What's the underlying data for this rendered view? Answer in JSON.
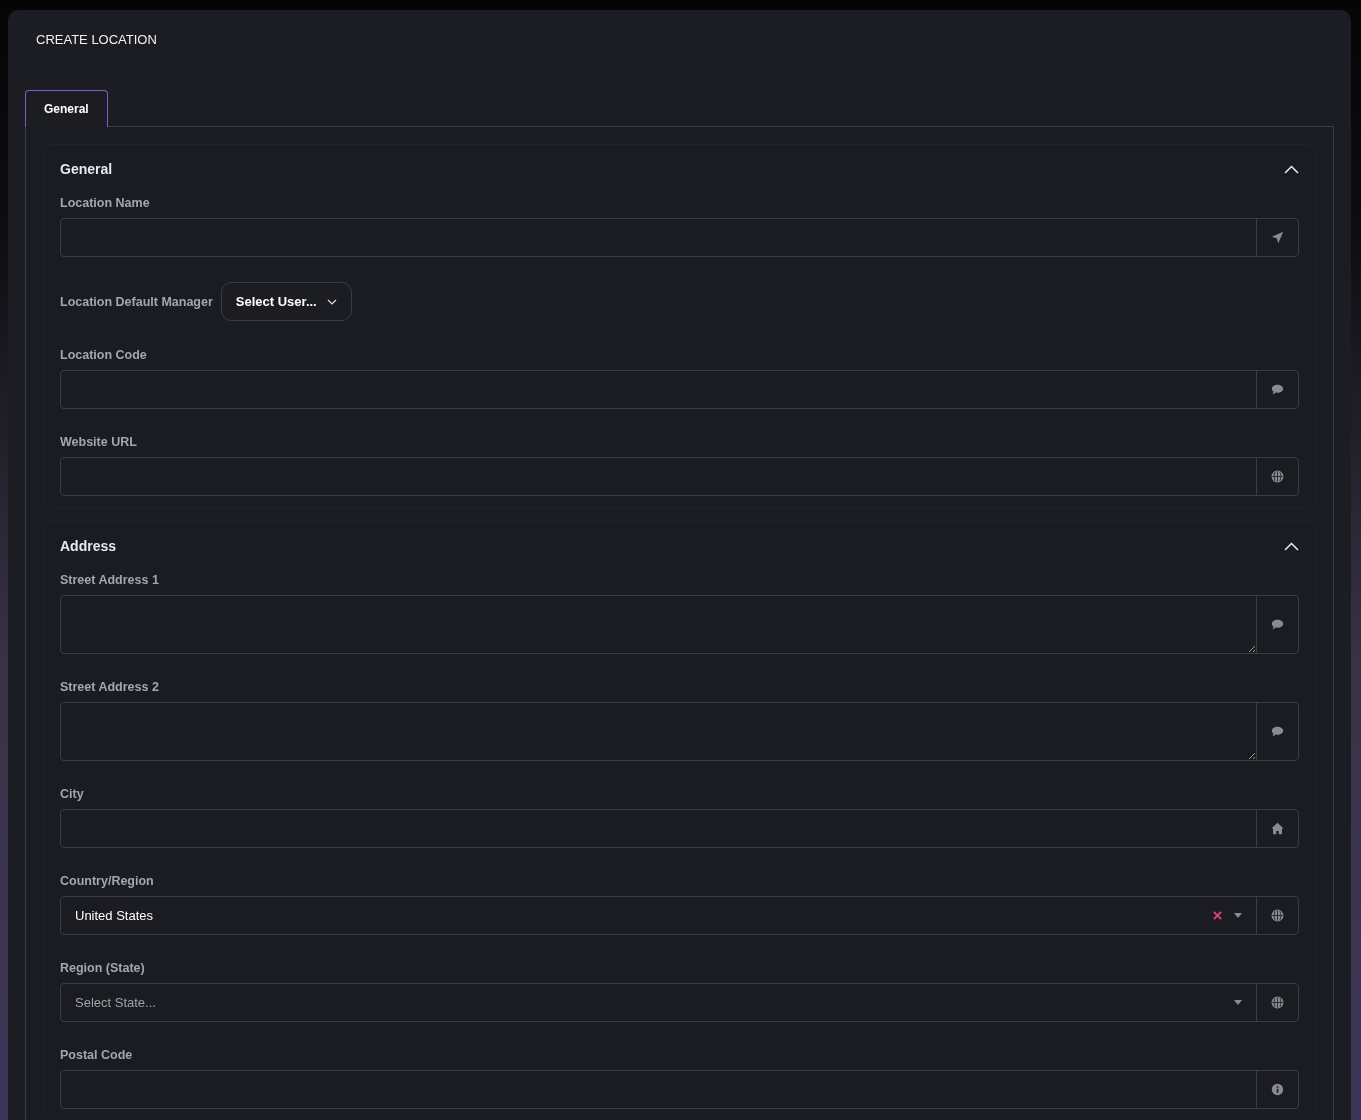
{
  "page_title": "CREATE LOCATION",
  "tabs": [
    {
      "label": "General",
      "selected": true
    }
  ],
  "sections": [
    {
      "title": "General",
      "expanded": true,
      "fields": [
        {
          "kind": "input",
          "label": "Location Name"
        },
        {
          "kind": "user-select",
          "label": "Location Default Manager",
          "placeholder": "Select User..."
        },
        {
          "kind": "input",
          "label": "Location Code"
        },
        {
          "kind": "input",
          "label": "Website URL"
        }
      ]
    },
    {
      "title": "Address",
      "expanded": true,
      "fields": [
        {
          "kind": "textarea",
          "label": "Street Address 1"
        },
        {
          "kind": "textarea",
          "label": "Street Address 2"
        },
        {
          "kind": "input",
          "label": "City"
        },
        {
          "kind": "select",
          "label": "Country/Region",
          "value": "United States",
          "clearable": true
        },
        {
          "kind": "select",
          "label": "Region (State)",
          "placeholder": "Select State...",
          "clearable": false
        },
        {
          "kind": "input",
          "label": "Postal Code"
        }
      ]
    }
  ]
}
